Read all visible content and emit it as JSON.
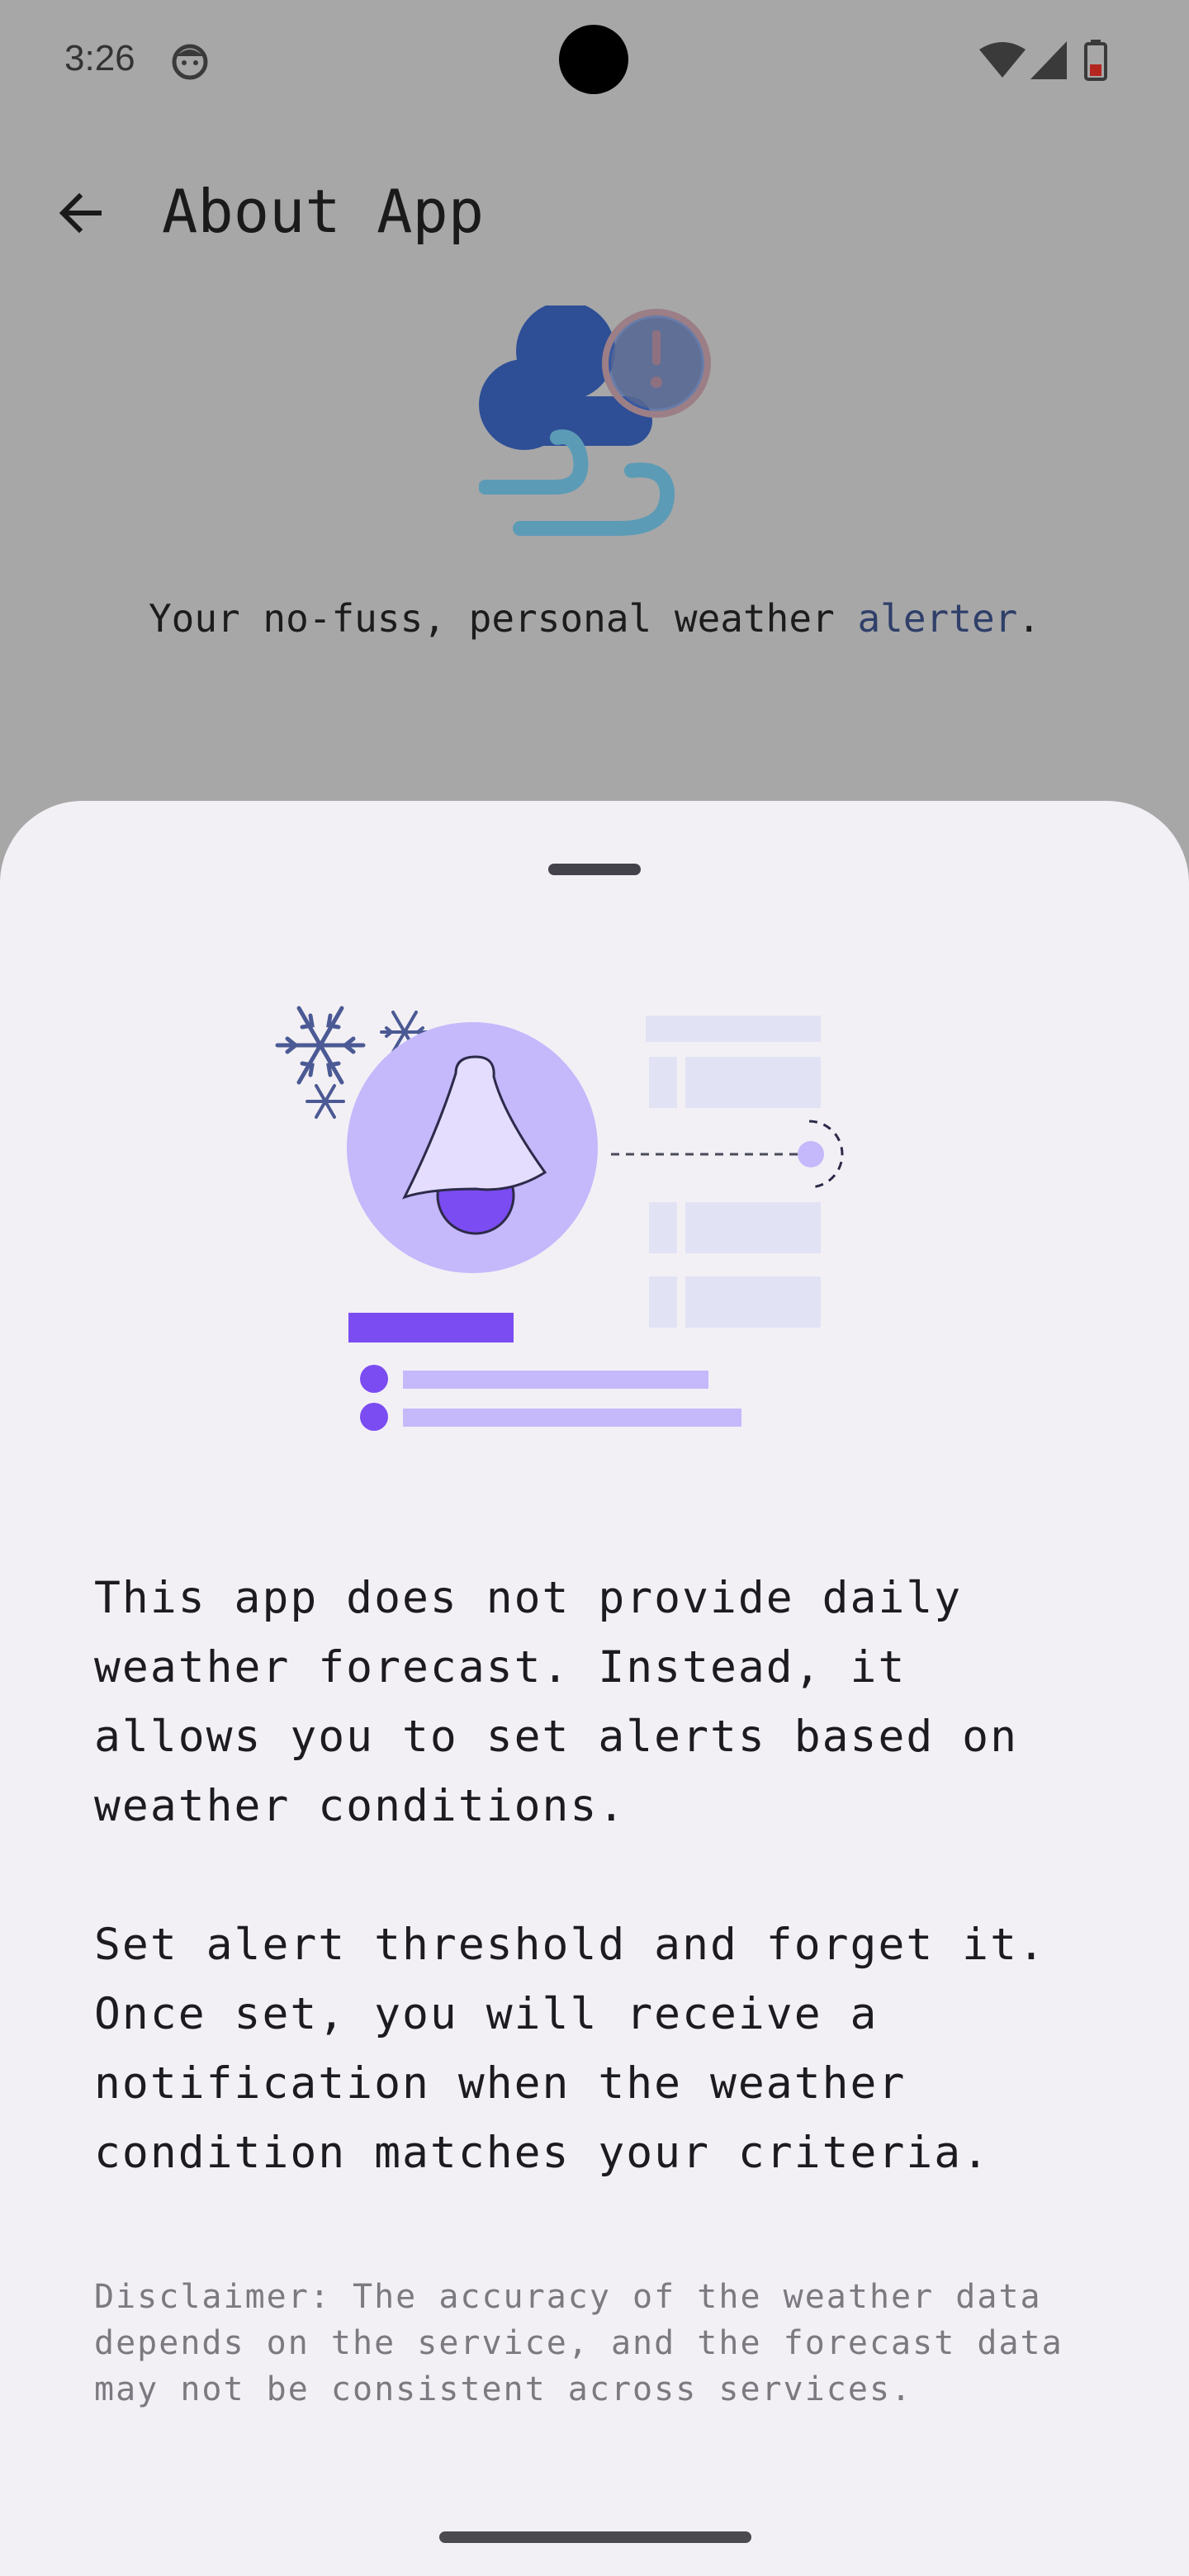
{
  "status_bar": {
    "time": "3:26",
    "icons": [
      "face-icon",
      "wifi-icon",
      "cell-signal-icon",
      "battery-icon"
    ]
  },
  "app_bar": {
    "back_icon": "arrow-left-icon",
    "title": "About App"
  },
  "hero": {
    "logo_icon": "weather-alert-cloud-icon",
    "tagline_prefix": "Your no-fuss, personal weather ",
    "tagline_accent": "alerter",
    "tagline_suffix": "."
  },
  "sheet": {
    "illustration_icon": "notification-bell-illustration",
    "paragraph_1": "This app does not provide daily\nweather forecast. Instead, it\nallows you to set alerts based on\nweather conditions.",
    "paragraph_2": "Set alert threshold and forget it.\nOnce set, you will receive a\nnotification when the weather\ncondition matches your criteria.",
    "disclaimer": "Disclaimer: The accuracy of the weather data\ndepends on the service, and the forecast data\nmay not be consistent across services."
  },
  "colors": {
    "scrim": "#a7a7a8",
    "sheet_bg": "#f3f0f5",
    "accent_purple": "#7b4cf2",
    "light_purple": "#c5b8fb",
    "tagline_accent": "#2f3f69"
  }
}
